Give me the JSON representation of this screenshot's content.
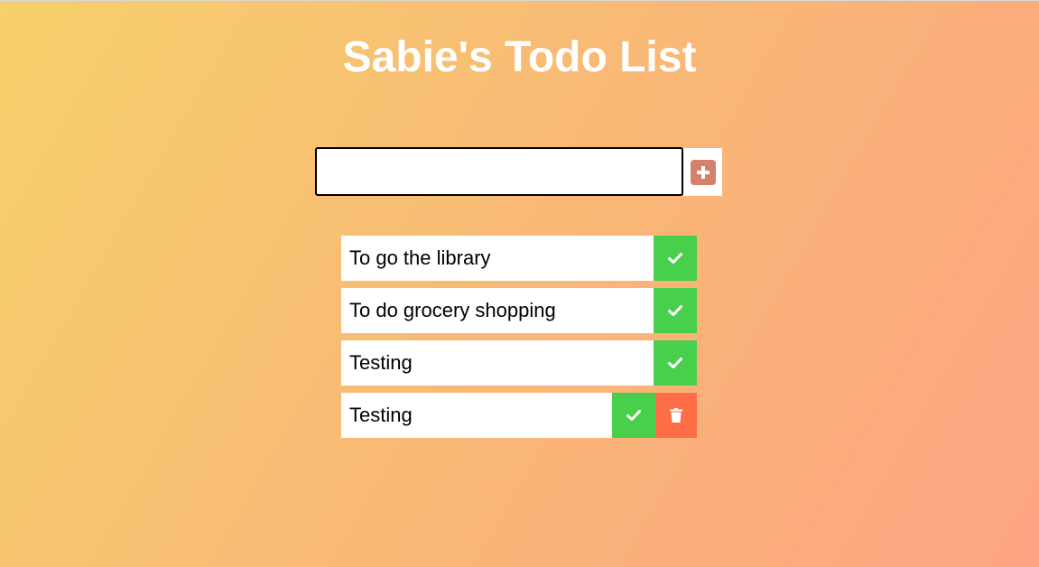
{
  "title": "Sabie's Todo List",
  "input": {
    "value": "",
    "placeholder": ""
  },
  "add_button": {
    "icon": "plus-square-icon"
  },
  "todos": [
    {
      "text": "To go the library",
      "actions": [
        "check-icon"
      ]
    },
    {
      "text": "To do grocery shopping",
      "actions": [
        "check-icon"
      ]
    },
    {
      "text": "Testing",
      "actions": [
        "check-icon"
      ]
    },
    {
      "text": "Testing",
      "actions": [
        "check-icon",
        "trash-icon"
      ]
    }
  ],
  "colors": {
    "complete": "#48cf4c",
    "delete": "#ff6f47",
    "add_icon": "#d4806b",
    "title": "#ffffff"
  }
}
